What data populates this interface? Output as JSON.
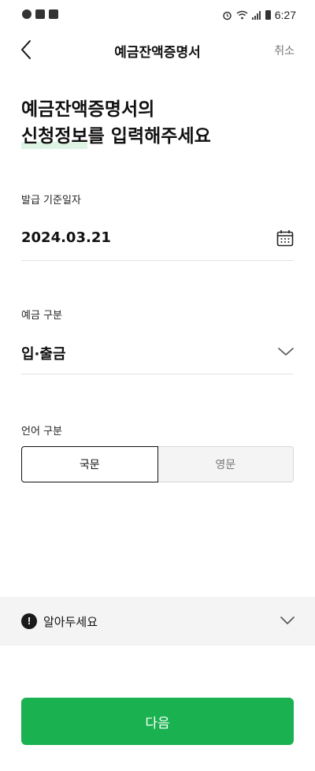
{
  "status_bar": {
    "time": "6:27",
    "left_icons": [
      "minus-circle-icon",
      "image-icon",
      "flipboard-icon"
    ],
    "right_icons": [
      "alarm-icon",
      "wifi-icon",
      "signal-icon",
      "battery-icon"
    ]
  },
  "header": {
    "title": "예금잔액증명서",
    "cancel_label": "취소",
    "back_icon": "chevron-left-icon"
  },
  "headline": {
    "line1": "예금잔액증명서의",
    "line2": "신청정보를 입력해주세요"
  },
  "form": {
    "issue_date": {
      "label": "발급 기준일자",
      "value": "2024.03.21",
      "icon": "calendar-icon"
    },
    "deposit_type": {
      "label": "예금 구분",
      "value": "입·출금",
      "icon": "chevron-down-icon"
    },
    "language": {
      "label": "언어 구분",
      "options": [
        "국문",
        "영문"
      ],
      "selected": "국문"
    }
  },
  "notice": {
    "label": "알아두세요",
    "icon_glyph": "!"
  },
  "next_button": {
    "label": "다음"
  },
  "colors": {
    "accent": "#1ab150",
    "notice_bg": "#f4f4f4"
  }
}
